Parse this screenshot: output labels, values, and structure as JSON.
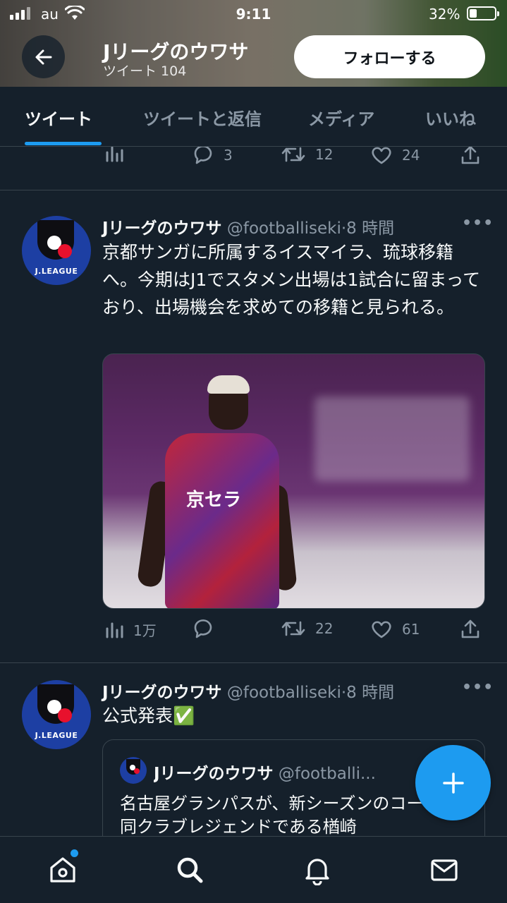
{
  "status_bar": {
    "carrier": "au",
    "time": "9:11",
    "battery": "32%"
  },
  "header": {
    "title": "Jリーグのウワサ",
    "subtitle": "ツイート 104",
    "follow_label": "フォローする"
  },
  "tabs": [
    {
      "label": "ツイート",
      "active": true
    },
    {
      "label": "ツイートと返信",
      "active": false
    },
    {
      "label": "メディア",
      "active": false
    },
    {
      "label": "いいね",
      "active": false
    }
  ],
  "prev_tweet_actions": {
    "replies": "3",
    "retweets": "12",
    "likes": "24"
  },
  "tweets": [
    {
      "name": "Jリーグのウワサ",
      "handle": "@footballiseki",
      "time": "·8 時間",
      "text": "京都サンガに所属するイスマイラ、琉球移籍へ。今期はJ1でスタメン出場は1試合に留まっており、出場機会を求めての移籍と見られる。",
      "media_text": "京セラ",
      "views": "1万",
      "retweets": "22",
      "likes": "61"
    },
    {
      "name": "Jリーグのウワサ",
      "handle": "@footballiseki",
      "time": "·8 時間",
      "text": "公式発表✅",
      "quote": {
        "name": "Jリーグのウワサ",
        "handle": "@footballi...",
        "text": "名古屋グランパスが、新シーズンのコーチに同クラブレジェンドである楢崎"
      }
    }
  ],
  "avatar_wordmark": "J.LEAGUE",
  "colors": {
    "background": "#15202b",
    "accent": "#1d9bf0",
    "muted": "#8b98a5",
    "divider": "#38444d"
  },
  "icons": {
    "back": "arrow-left-icon",
    "fab": "plus-icon",
    "nav": [
      "home-icon",
      "search-icon",
      "bell-icon",
      "mail-icon"
    ]
  }
}
